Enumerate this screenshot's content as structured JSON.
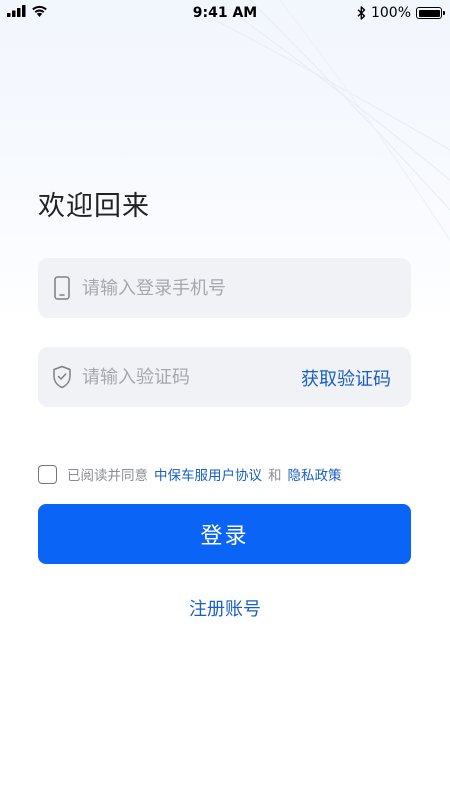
{
  "status_bar": {
    "time": "9:41 AM",
    "battery_text": "100%",
    "battery_level": 1.0,
    "icons": [
      "signal-icon",
      "wifi-icon",
      "bluetooth-icon",
      "battery-icon"
    ]
  },
  "login": {
    "title": "欢迎回来",
    "phone_placeholder": "请输入登录手机号",
    "phone_value": "",
    "code_placeholder": "请输入验证码",
    "code_value": "",
    "get_code_label": "获取验证码",
    "agreement": {
      "checked": false,
      "prefix": "已阅读并同意",
      "user_agreement": "中保车服用户协议",
      "conjunction": "和",
      "privacy_policy": "隐私政策"
    },
    "login_button": "登录",
    "register_link": "注册账号"
  },
  "colors": {
    "primary": "#0a64f5",
    "link": "#1a5fc4",
    "field_bg": "#f1f2f6",
    "placeholder": "#a6a8ad"
  }
}
